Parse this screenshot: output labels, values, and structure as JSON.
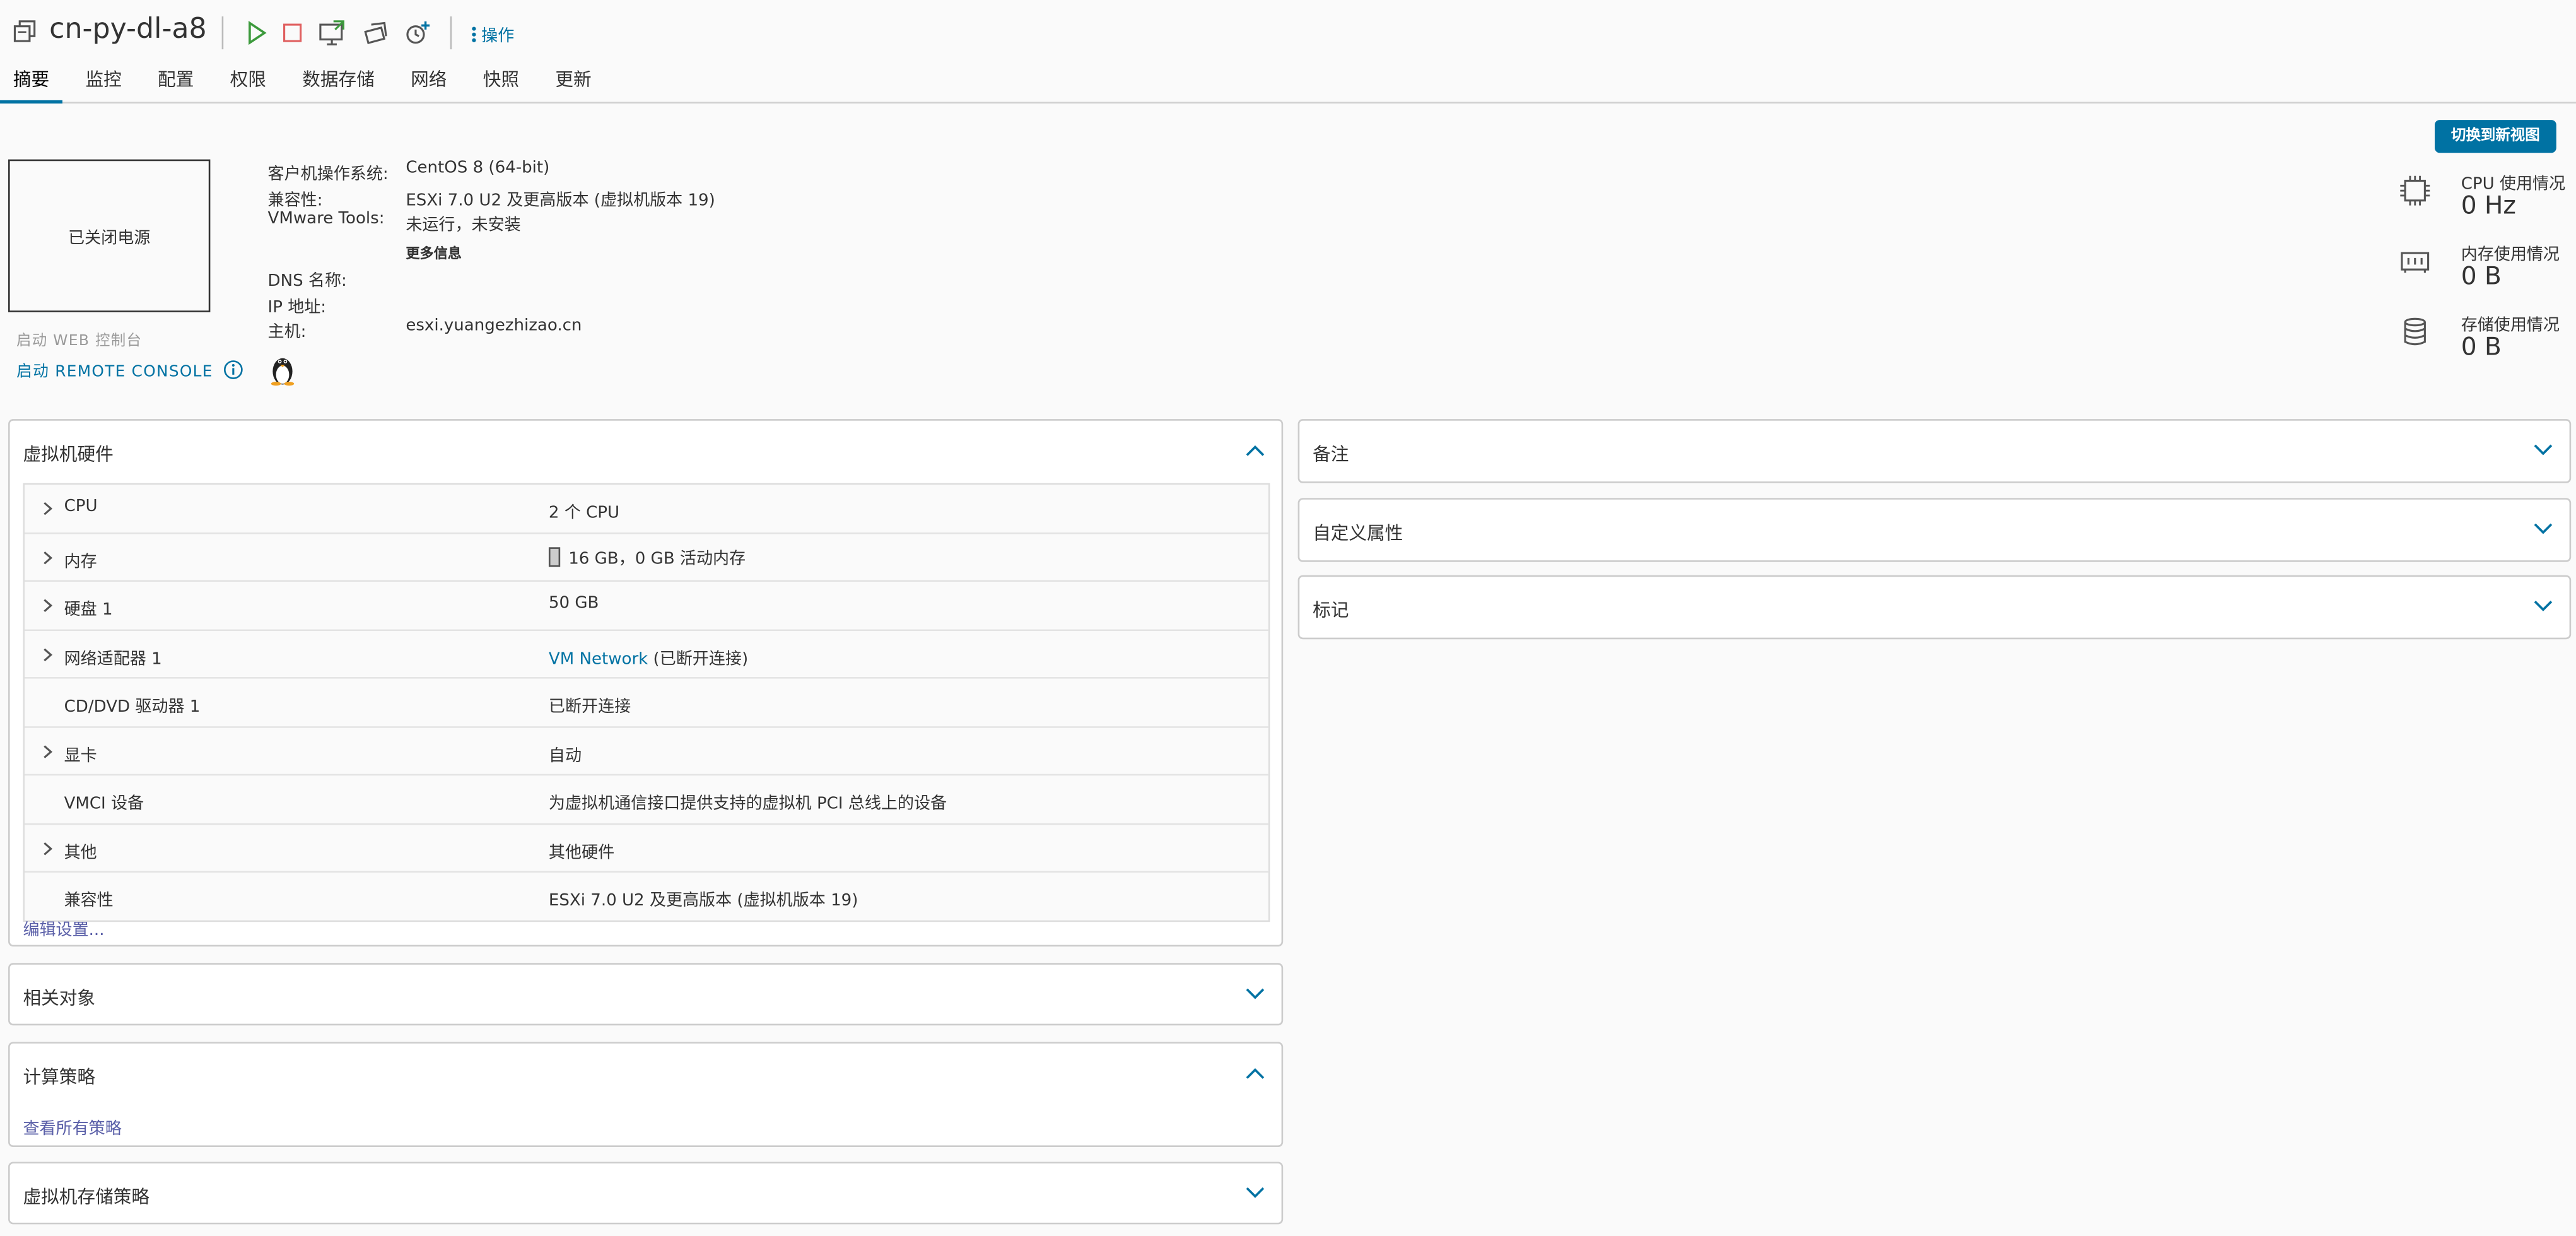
{
  "header": {
    "vm_name": "cn-py-dl-a8",
    "actions_label": "操作",
    "tabs": [
      {
        "label": "摘要",
        "active": true
      },
      {
        "label": "监控"
      },
      {
        "label": "配置"
      },
      {
        "label": "权限"
      },
      {
        "label": "数据存储"
      },
      {
        "label": "网络"
      },
      {
        "label": "快照"
      },
      {
        "label": "更新"
      }
    ]
  },
  "summary": {
    "switch_view_label": "切换到新视图",
    "power_state": "已关闭电源",
    "web_console_label": "启动 WEB 控制台",
    "remote_console_label": "启动 REMOTE CONSOLE",
    "guest_os_key": "客户机操作系统:",
    "guest_os_value": "CentOS 8 (64-bit)",
    "compat_key": "兼容性:",
    "compat_value": "ESXi 7.0 U2 及更高版本 (虚拟机版本 19)",
    "tools_key": "VMware Tools:",
    "tools_value": "未运行，未安装",
    "more_info_label": "更多信息",
    "dns_key": "DNS 名称:",
    "ip_key": "IP 地址:",
    "host_key": "主机:",
    "host_value": "esxi.yuangezhizao.cn"
  },
  "usage": {
    "cpu_label": "CPU 使用情况",
    "cpu_value": "0 Hz",
    "mem_label": "内存使用情况",
    "mem_value": "0 B",
    "storage_label": "存储使用情况",
    "storage_value": "0 B"
  },
  "hardware": {
    "title": "虚拟机硬件",
    "rows": [
      {
        "name": "CPU",
        "value": "2 个 CPU"
      },
      {
        "name": "内存",
        "value": "16 GB，0 GB 活动内存"
      },
      {
        "name": "硬盘 1",
        "value": "50 GB"
      },
      {
        "name": "网络适配器 1",
        "value_link": "VM Network",
        "value_rest": " (已断开连接)"
      },
      {
        "name": "CD/DVD 驱动器 1",
        "value": "已断开连接"
      },
      {
        "name": "显卡",
        "value": "自动"
      },
      {
        "name": "VMCI 设备",
        "value": "为虚拟机通信接口提供支持的虚拟机 PCI 总线上的设备"
      },
      {
        "name": "其他",
        "value": "其他硬件"
      },
      {
        "name": "兼容性",
        "value": "ESXi 7.0 U2 及更高版本 (虚拟机版本 19)"
      }
    ],
    "edit_settings_label": "编辑设置..."
  },
  "panels": {
    "related_objects": "相关对象",
    "compute_policy": "计算策略",
    "view_all_policies": "查看所有策略",
    "storage_policy": "虚拟机存储策略",
    "notes": "备注",
    "custom_attributes": "自定义属性",
    "tags": "标记"
  },
  "colors": {
    "accent": "#0072a3",
    "play": "#3c9a3c",
    "stop": "#e06060"
  }
}
